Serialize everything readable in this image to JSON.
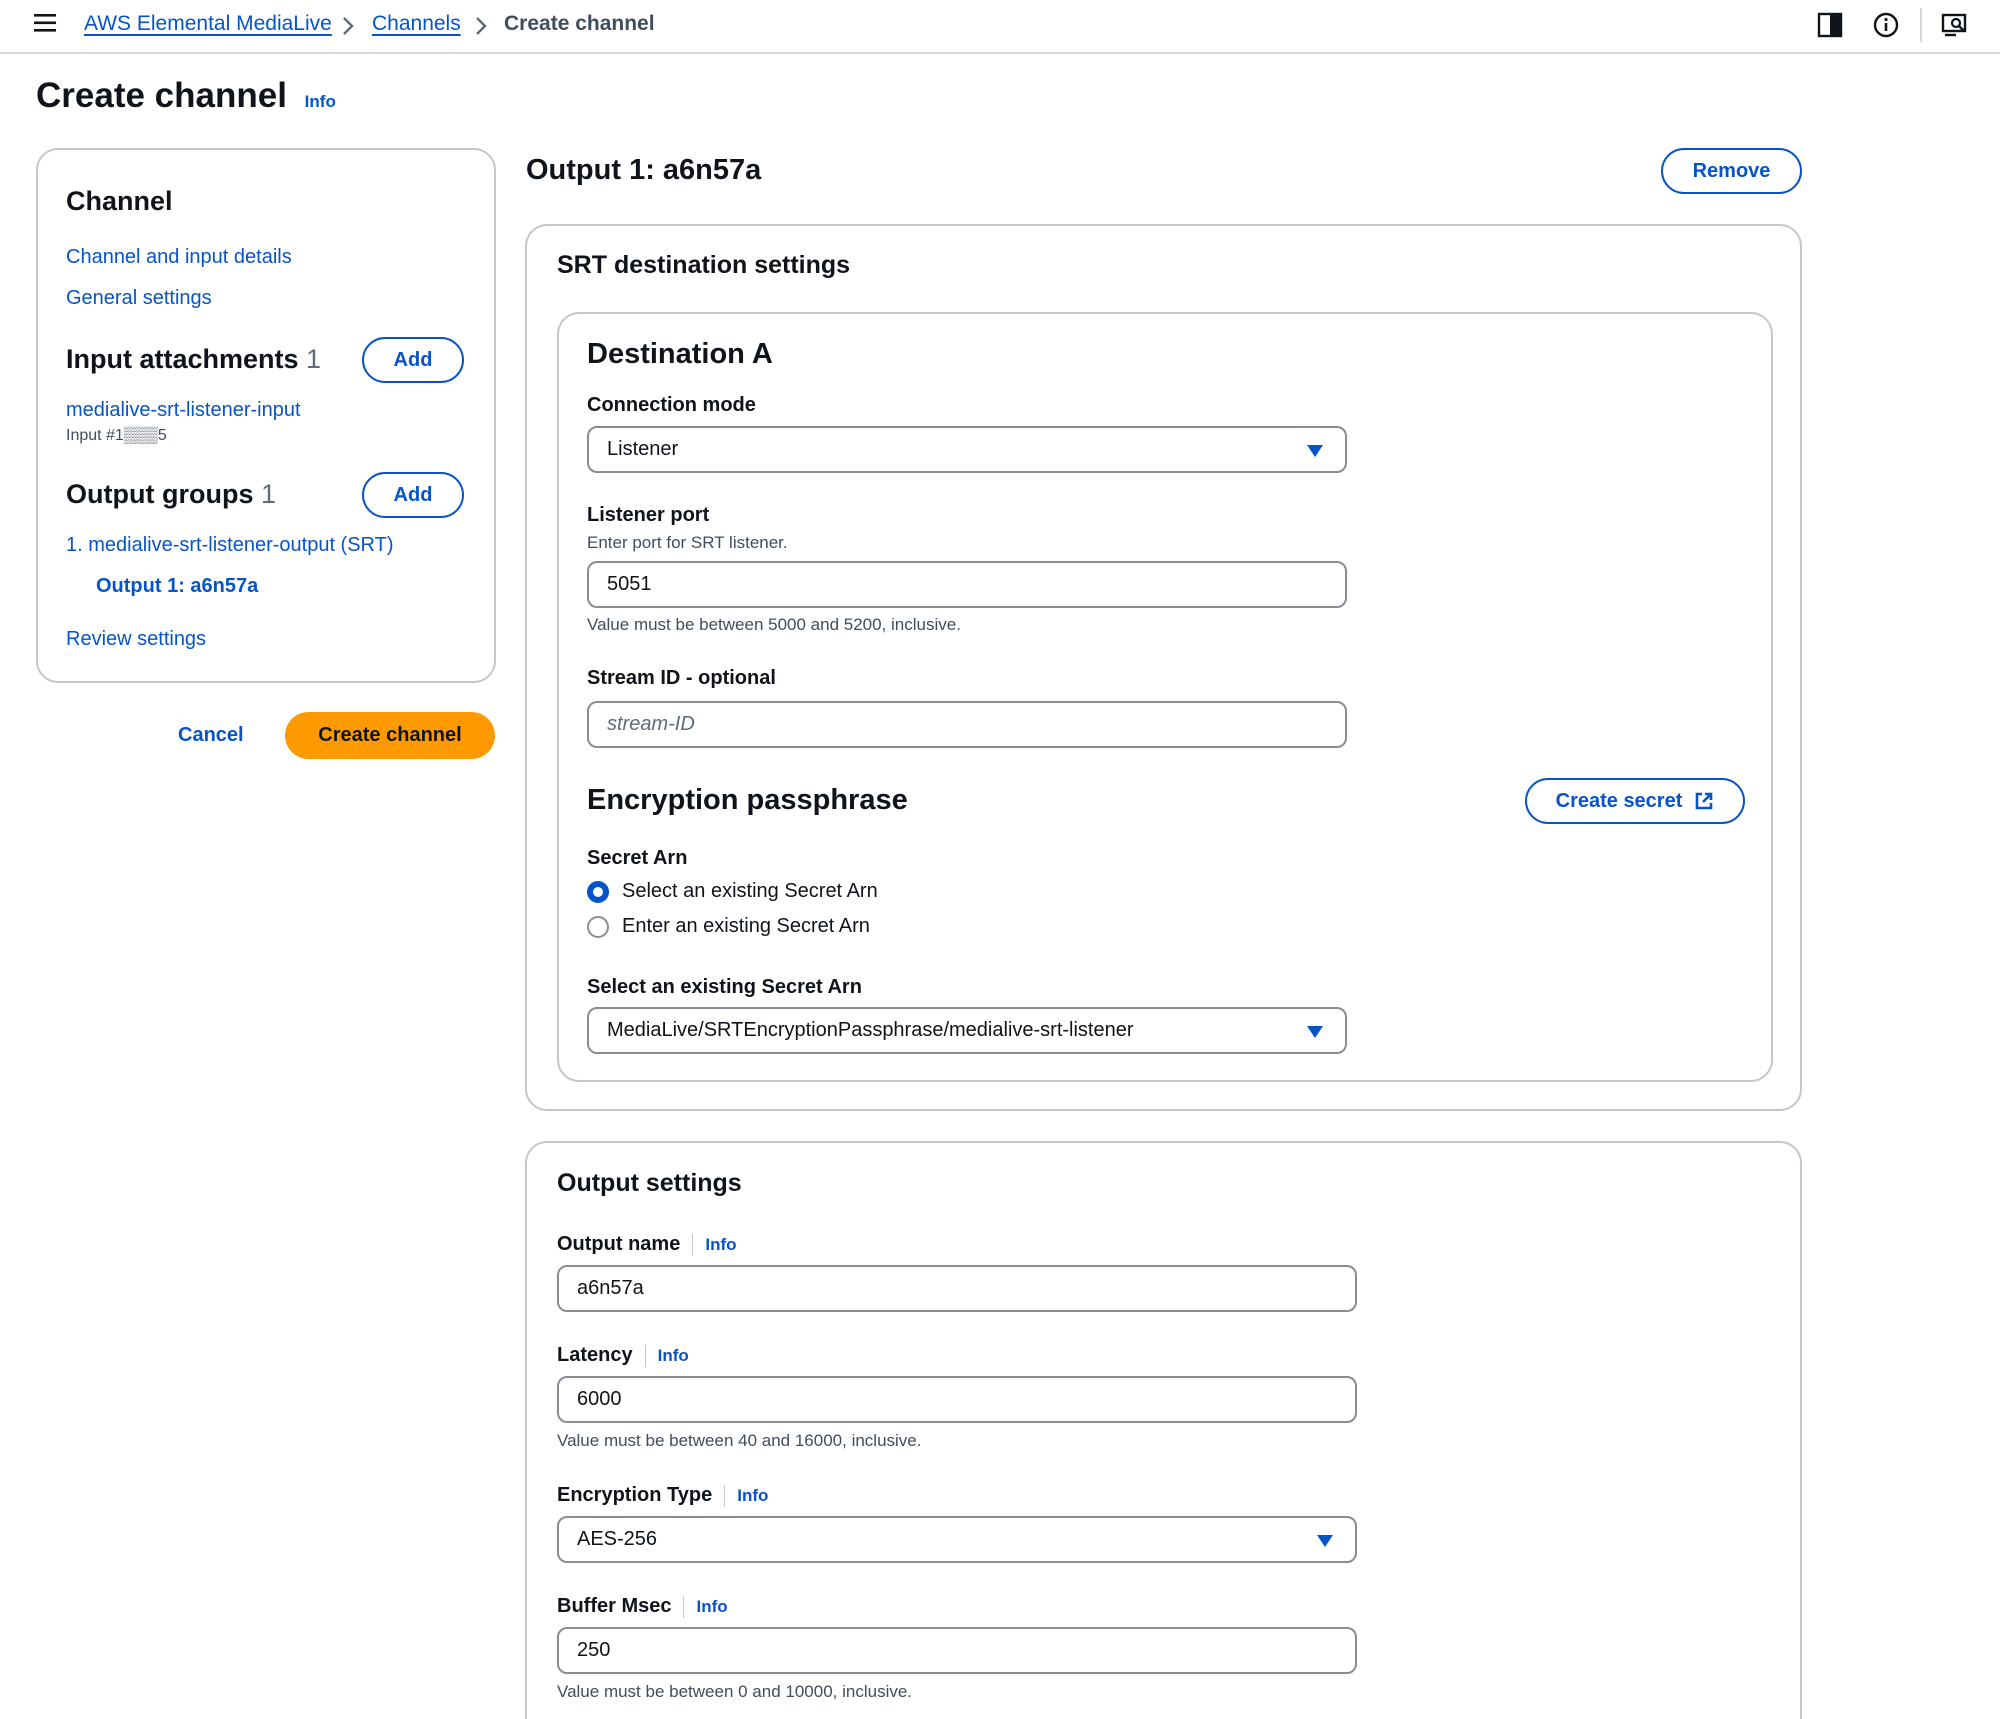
{
  "breadcrumbs": {
    "service": "AWS Elemental MediaLive",
    "channels": "Channels",
    "current": "Create channel"
  },
  "page": {
    "title": "Create channel",
    "info": "Info"
  },
  "nav": {
    "channel_heading": "Channel",
    "channel_links": [
      "Channel and input details",
      "General settings"
    ],
    "input_attachments_heading": "Input attachments",
    "input_attachments_count": "1",
    "input_add": "Add",
    "input_name": "medialive-srt-listener-input",
    "input_id": "Input #1▒▒▒5",
    "output_groups_heading": "Output groups",
    "output_groups_count": "1",
    "output_add": "Add",
    "output_group_item": "1. medialive-srt-listener-output (SRT)",
    "output_item": "Output 1: a6n57a",
    "review": "Review settings"
  },
  "actions": {
    "cancel": "Cancel",
    "create": "Create channel"
  },
  "output": {
    "title": "Output 1: a6n57a",
    "remove": "Remove"
  },
  "srt": {
    "heading": "SRT destination settings",
    "destination_heading": "Destination A",
    "connection_mode_label": "Connection mode",
    "connection_mode_value": "Listener",
    "listener_port_label": "Listener port",
    "listener_port_desc": "Enter port for SRT listener.",
    "listener_port_value": "5051",
    "listener_port_hint": "Value must be between 5000 and 5200, inclusive.",
    "stream_id_label": "Stream ID - optional",
    "stream_id_placeholder": "stream-ID",
    "encryption_heading": "Encryption passphrase",
    "create_secret": "Create secret",
    "secret_arn_label": "Secret Arn",
    "radio_options": [
      "Select an existing Secret Arn",
      "Enter an existing Secret Arn"
    ],
    "selected_radio": 0,
    "select_secret_label": "Select an existing Secret Arn",
    "select_secret_value": "MediaLive/SRTEncryptionPassphrase/medialive-srt-listener"
  },
  "output_settings": {
    "heading": "Output settings",
    "info": "Info",
    "output_name_label": "Output name",
    "output_name_value": "a6n57a",
    "latency_label": "Latency",
    "latency_value": "6000",
    "latency_hint": "Value must be between 40 and 16000, inclusive.",
    "encryption_type_label": "Encryption Type",
    "encryption_type_value": "AES-256",
    "buffer_label": "Buffer Msec",
    "buffer_value": "250",
    "buffer_hint": "Value must be between 0 and 10000, inclusive."
  },
  "colors": {
    "link": "#0654c8",
    "primary_button": "#ff9900",
    "border": "#c6c6cd",
    "text": "#0f141a"
  }
}
